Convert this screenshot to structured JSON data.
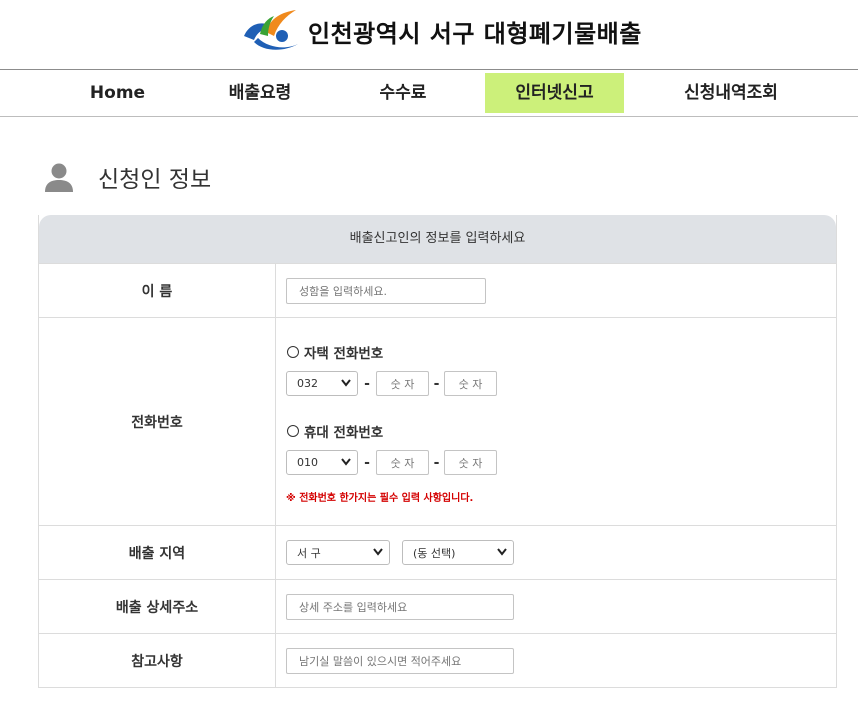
{
  "header": {
    "title": "인천광역시 서구 대형폐기물배출"
  },
  "nav": {
    "items": [
      {
        "label": "Home",
        "active": false
      },
      {
        "label": "배출요령",
        "active": false
      },
      {
        "label": "수수료",
        "active": false
      },
      {
        "label": "인터넷신고",
        "active": true
      },
      {
        "label": "신청내역조회",
        "active": false
      }
    ]
  },
  "section": {
    "title": "신청인 정보"
  },
  "form": {
    "heading": "배출신고인의 정보를 입력하세요",
    "name": {
      "label": "이 름",
      "placeholder": "성함을 입력하세요."
    },
    "phone": {
      "label": "전화번호",
      "home_label": "자택 전화번호",
      "home_area": "032",
      "mobile_label": "휴대 전화번호",
      "mobile_prefix": "010",
      "number_placeholder": "숫 자",
      "notice": "※ 전화번호 한가지는 필수 입력 사항입니다."
    },
    "region": {
      "label": "배출 지역",
      "district": "서 구",
      "dong": "(동 선택)"
    },
    "address": {
      "label": "배출 상세주소",
      "placeholder": "상세 주소를 입력하세요"
    },
    "memo": {
      "label": "참고사항",
      "placeholder": "남기실 말씀이 있으시면 적어주세요"
    }
  },
  "colors": {
    "nav_active": "#ccf07a",
    "form_header_bg": "#dfe2e6",
    "warning": "#d40000",
    "logo_blue": "#1f5fb5",
    "logo_orange": "#f08a1d",
    "logo_green": "#3aa335"
  }
}
